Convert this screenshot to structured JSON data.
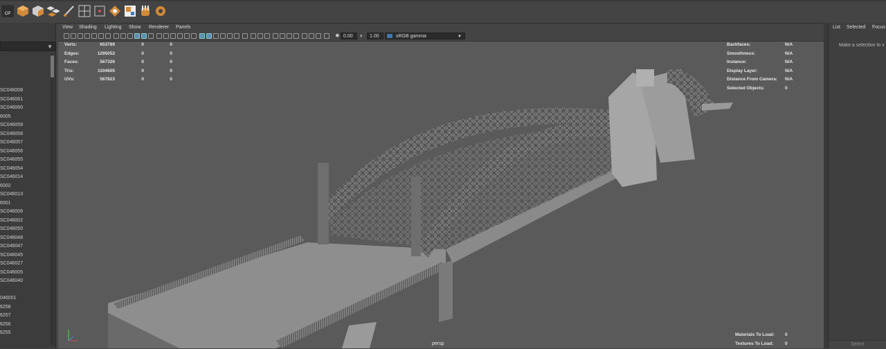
{
  "shelf": {
    "icons": [
      "camera-icon",
      "cube-icon",
      "cube-faces-icon",
      "cluster-icon",
      "paint-icon",
      "lattice-grid-icon",
      "cluster-frame-icon",
      "hypershade-icon",
      "uv-editor-icon",
      "sculpt-hand-icon",
      "render-view-icon"
    ],
    "cp_label": "CP"
  },
  "outliner": {
    "items": [
      "SC046008",
      "SC046061",
      "SC046060",
      "6005",
      "SC046059",
      "SC046058",
      "SC046057",
      "SC046056",
      "SC046055",
      "SC046054",
      "SC046014",
      "6002",
      "SC046013",
      "6001",
      "SC046006",
      "SC046002",
      "SC046050",
      "SC046048",
      "SC046047",
      "SC046045",
      "SC046027",
      "SC046005",
      "SC046040",
      "",
      "046001",
      "6258",
      "6257",
      "6256",
      "6255"
    ]
  },
  "viewport_menu": [
    "View",
    "Shading",
    "Lighting",
    "Show",
    "Renderer",
    "Panels"
  ],
  "toolbar": {
    "exposure": "0.00",
    "gamma": "1.00",
    "colorspace": "sRGB gamma"
  },
  "hud_left": [
    {
      "label": "Verts:",
      "a": "653789",
      "b": "0",
      "c": "0"
    },
    {
      "label": "Edges:",
      "a": "1295052",
      "b": "0",
      "c": "0"
    },
    {
      "label": "Faces:",
      "a": "567326",
      "b": "0",
      "c": "0"
    },
    {
      "label": "Tris:",
      "a": "1104605",
      "b": "0",
      "c": "0"
    },
    {
      "label": "UVs:",
      "a": "567823",
      "b": "0",
      "c": "0"
    }
  ],
  "hud_right": [
    {
      "label": "Backfaces:",
      "value": "N/A"
    },
    {
      "label": "Smoothness:",
      "value": "N/A"
    },
    {
      "label": "Instance:",
      "value": "N/A"
    },
    {
      "label": "Display Layer:",
      "value": "N/A"
    },
    {
      "label": "Distance From Camera:",
      "value": "N/A"
    },
    {
      "label": "Selected Objects:",
      "value": "0"
    }
  ],
  "hud_bottom": [
    {
      "label": "Materials To Load:",
      "value": "0"
    },
    {
      "label": "Textures To Load:",
      "value": "0"
    }
  ],
  "camera_name": "persp",
  "channel_box": {
    "tabs": [
      "List",
      "Selected",
      "Focus"
    ],
    "hint": "Make a selection to v",
    "select_label": "Select"
  }
}
